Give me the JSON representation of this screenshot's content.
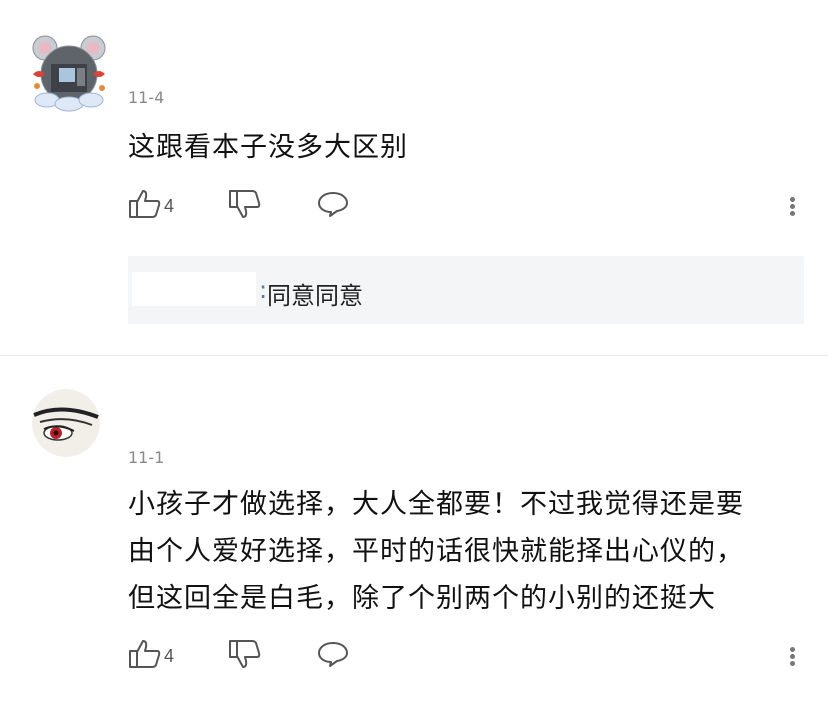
{
  "comments": [
    {
      "date": "11-4",
      "text": "这跟看本子没多大区别",
      "likes": "4",
      "reply": {
        "separator": ":",
        "text": "同意同意"
      }
    },
    {
      "date": "11-1",
      "lines": [
        "小孩子才做选择，大人全都要！不过我觉得还是要",
        "由个人爱好选择，平时的话很快就能择出心仪的，",
        "但这回全是白毛，除了个别两个的小别的还挺大"
      ],
      "likes": "4"
    }
  ],
  "icons": {
    "like": "thumbs-up-icon",
    "dislike": "thumbs-down-icon",
    "reply": "comment-bubble-icon",
    "more": "more-vertical-icon"
  },
  "colors": {
    "text": "#111111",
    "date": "#8a8a8a",
    "reply_bg": "#f3f5f7",
    "reply_name": "#5f7a99"
  }
}
